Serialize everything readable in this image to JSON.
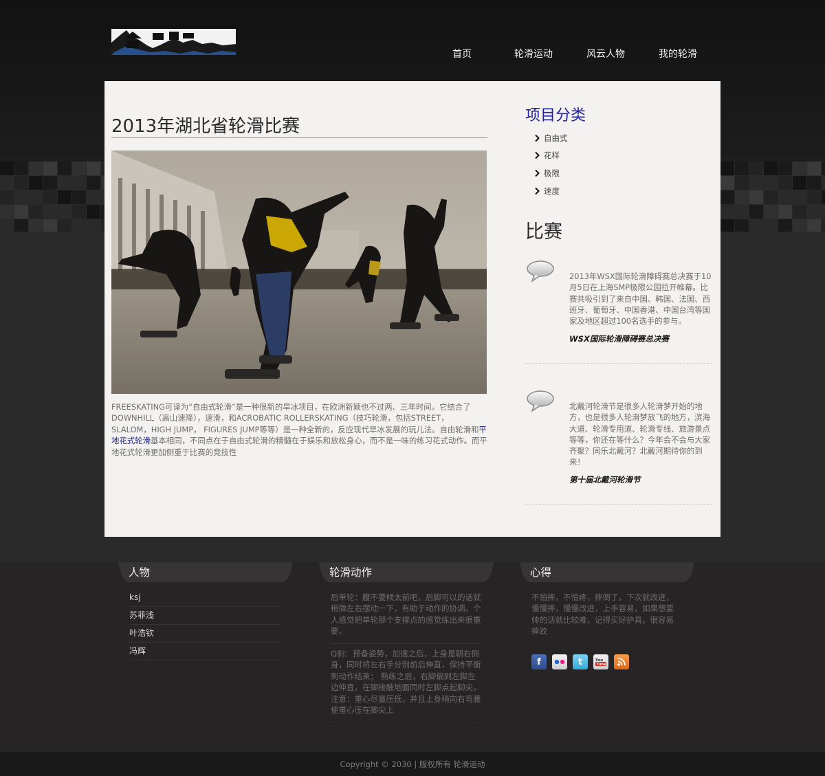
{
  "header": {
    "logo_alt": "WET",
    "nav": [
      "首页",
      "轮滑运动",
      "风云人物",
      "我的轮滑"
    ]
  },
  "article": {
    "title": "2013年湖北省轮滑比赛",
    "photo_alt": "轮滑比赛照片",
    "body_before_link": "FREESKATING可译为“自由式轮滑”是一种很新的旱冰项目，在欧洲新颖也不过两、三年时间。它结合了DOWNHILL（高山速降），速滑，和ACROBATIC ROLLERSKATING（技巧轮滑，包括STREET，SLALOM，HIGH JUMP， FIGURES JUMP等等）是一种全新的，反应现代旱冰发展的玩儿法。自由轮滑和",
    "body_link": "平地花式轮滑",
    "body_after_link": "基本相同，不同点在于自由式轮滑的精髓在于娱乐和放松身心，而不是一味的练习花式动作。而平地花式轮滑更加侧重于比赛的竞技性"
  },
  "sidebar": {
    "category_heading": "项目分类",
    "categories": [
      "自由式",
      "花样",
      "极限",
      "速度"
    ],
    "race_heading": "比赛",
    "races": [
      {
        "text": "2013年WSX国际轮滑障碍赛总决赛于10月5日在上海SMP极限公园拉开帷幕。比赛共吸引到了来自中国、韩国、法国、西班牙、葡萄牙、中国香港、中国台湾等国家及地区超过100名选手的参与。",
        "title": "WSX国际轮滑障碍赛总决赛"
      },
      {
        "text": "北戴河轮滑节是很多人轮滑梦开始的地方，也是很多人轮滑梦放飞的地方，滨海大道、轮滑专用道、轮滑专线、旅游景点等等，你还在等什么？今年会不会与大家齐聚？同乐北戴河？北戴河期待你的到来！",
        "title": "第十届北戴河轮滑节"
      }
    ]
  },
  "footer": {
    "people_heading": "人物",
    "people": [
      "ksj",
      "苏菲浅",
      "叶浩钦",
      "冯辉"
    ],
    "moves_heading": "轮滑动作",
    "moves": [
      "后单轮：腰不要倾太前吧，后脚可以的话就稍微左右摆动一下，有助于动作的协调。个人感觉把单轮那个支撑点的感觉练出来很重要。",
      "Q刹：预备姿势，加速之后，上身是朝右侧身，同时将左右手分别前后伸直，保持平衡到动作结束； 熟练之后，右脚偏到左脚左边伸直，在脚接触地面同时左脚点起脚尖，注意：重心尽量压低，并且上身稍向右弯腰使重心压在脚尖上"
    ],
    "notes_heading": "心得",
    "notes": "不怕摔，不怕疼，摔倒了，下次就改进，慢慢摔，慢慢改进，上手容易，如果想耍帅的话就比较难，记得买好护具，很容易摔跤",
    "social": [
      "facebook-icon",
      "flickr-icon",
      "twitter-icon",
      "youtube-icon",
      "rss-icon"
    ],
    "copyright": "Copyright © 2030 | 版权所有 轮滑运动"
  },
  "colors": {
    "panel_bg": "#f3f2f1",
    "accent_blue": "#1f21a8",
    "link_blue": "#1d1f8f",
    "footer_bg": "#262424",
    "header_bg": "#121212"
  }
}
